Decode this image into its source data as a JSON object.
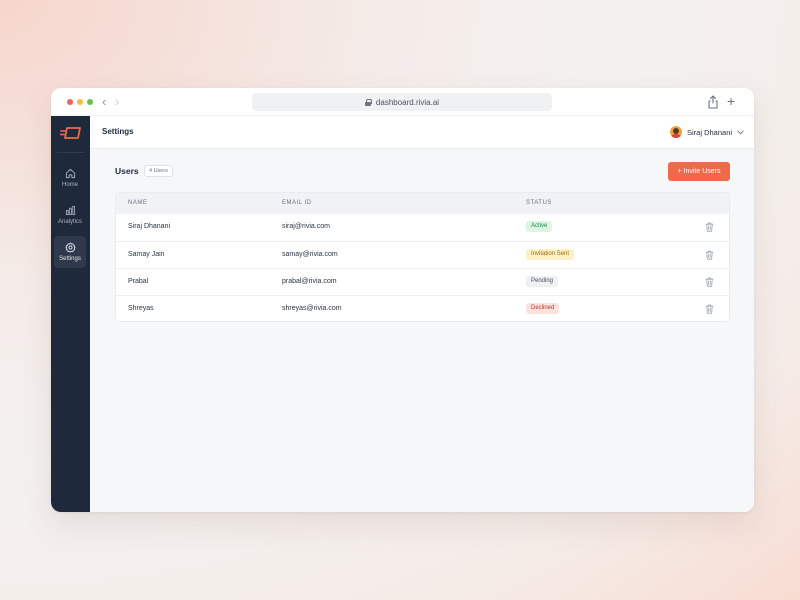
{
  "browser": {
    "url": "dashboard.rivia.ai"
  },
  "sidebar": {
    "items": [
      {
        "label": "Home",
        "icon": "home-icon"
      },
      {
        "label": "Analytics",
        "icon": "bar-chart-icon"
      },
      {
        "label": "Settings",
        "icon": "gear-icon",
        "active": true
      }
    ]
  },
  "header": {
    "title": "Settings",
    "user_name": "Siraj Dhanani"
  },
  "users_section": {
    "title": "Users",
    "count_label": "4 Users",
    "invite_label": "+ Invite Users"
  },
  "table": {
    "columns": [
      "NAME",
      "EMAIL ID",
      "STATUS"
    ],
    "rows": [
      {
        "name": "Siraj Dhanani",
        "email": "siraj@rivia.com",
        "status": "Active"
      },
      {
        "name": "Samay Jain",
        "email": "samay@rivia.com",
        "status": "Invitation Sent"
      },
      {
        "name": "Prabal",
        "email": "prabal@rivia.com",
        "status": "Pending"
      },
      {
        "name": "Shreyas",
        "email": "shreyas@rivia.com",
        "status": "Declined"
      }
    ]
  },
  "colors": {
    "accent": "#ee6a4b",
    "sidebar": "#1e2a3b",
    "status_active": "#1e8a44",
    "status_invited": "#9a6a0a",
    "status_pending": "#4a5261",
    "status_declined": "#c0392b"
  }
}
